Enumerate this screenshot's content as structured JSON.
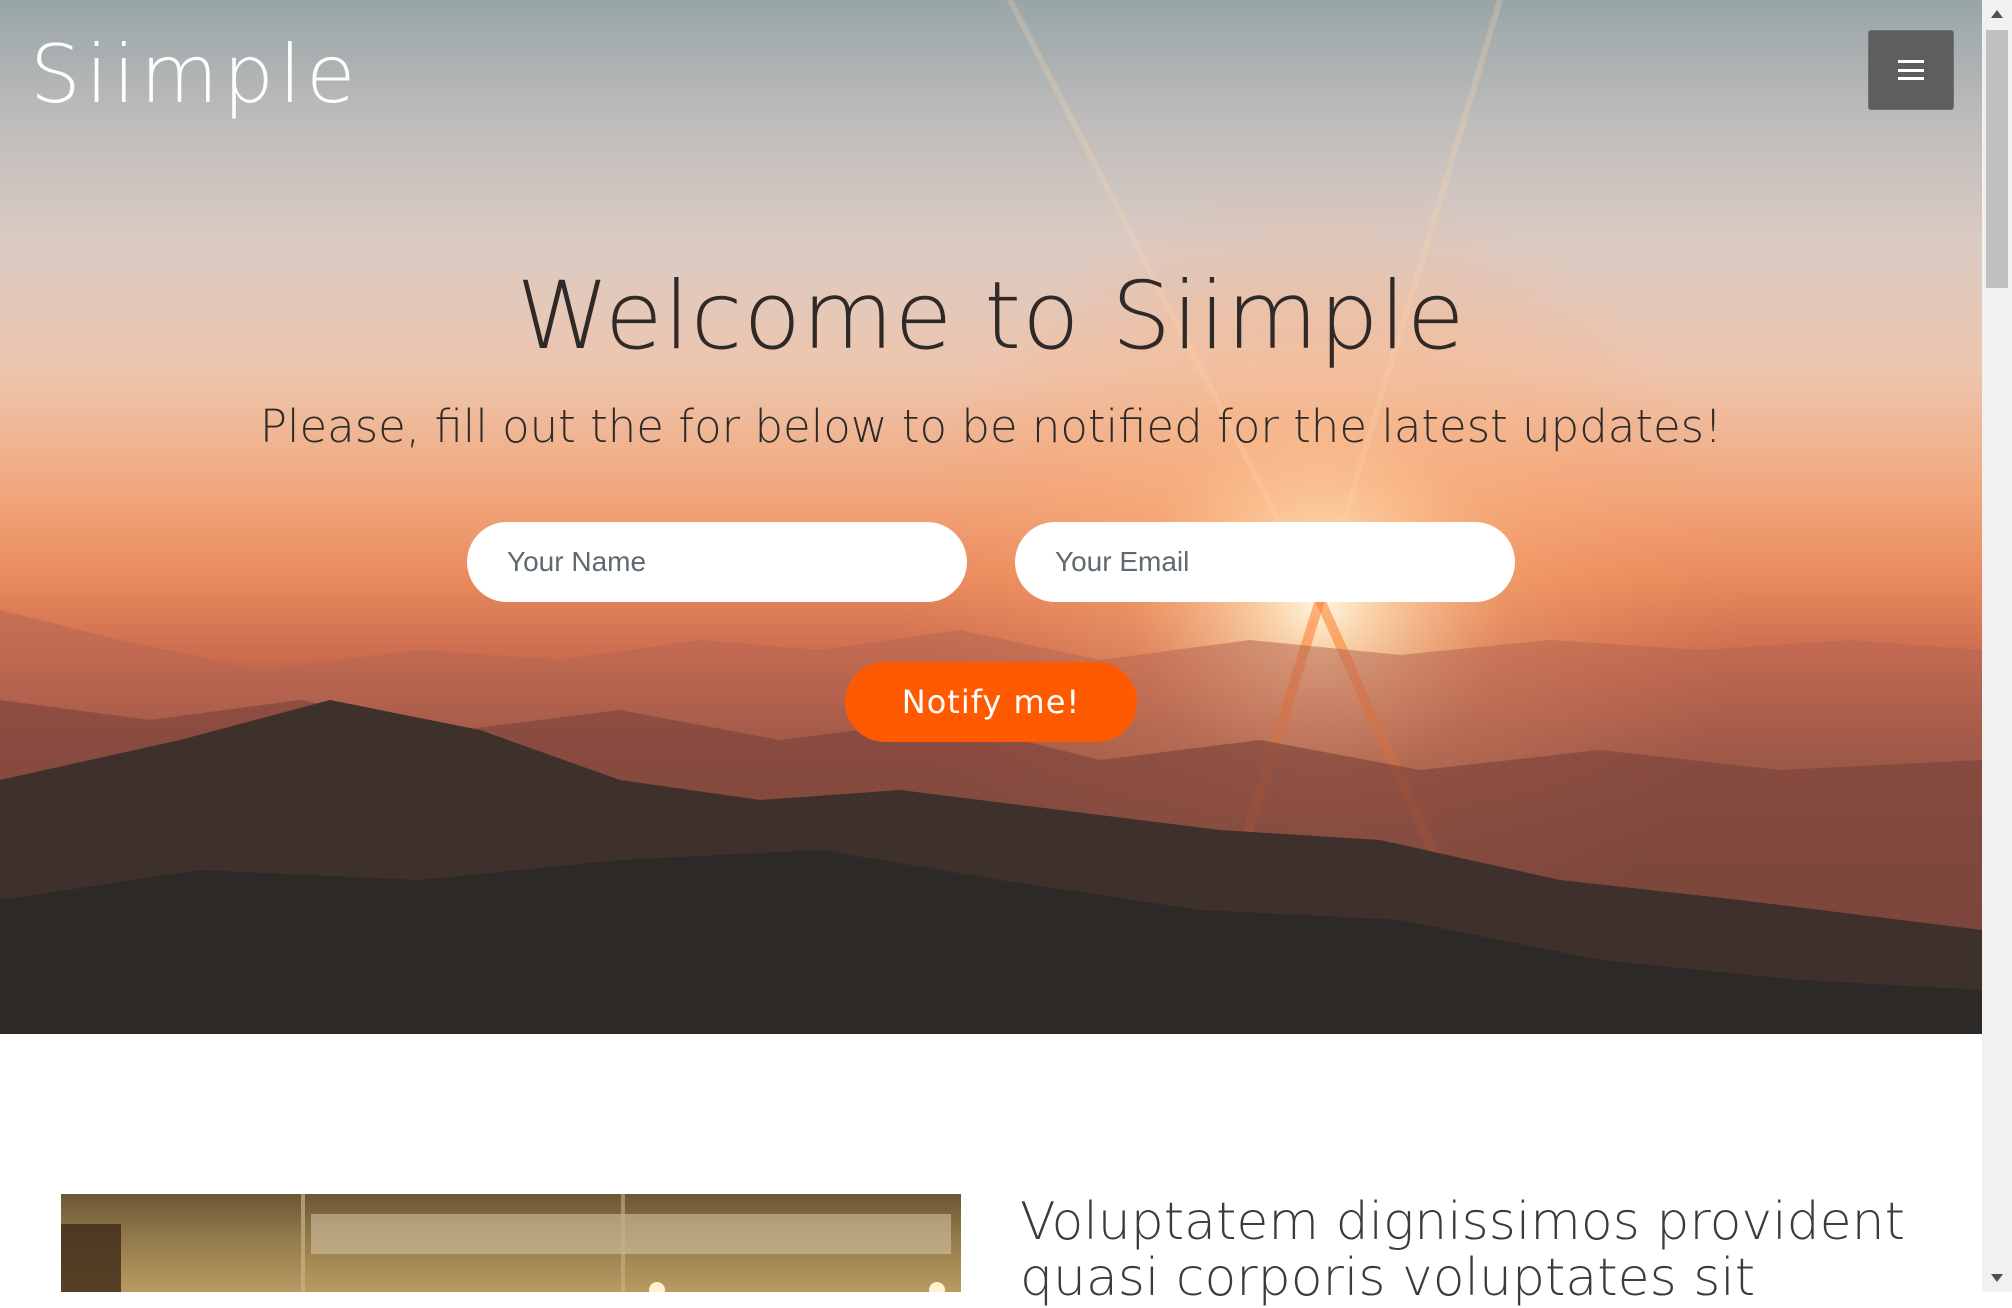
{
  "header": {
    "brand": "Siimple",
    "menu_icon": "hamburger-icon"
  },
  "hero": {
    "title": "Welcome to Siimple",
    "subtitle": "Please, fill out the for below to be notified for the latest updates!",
    "name_placeholder": "Your Name",
    "email_placeholder": "Your Email",
    "button_label": "Notify me!"
  },
  "section": {
    "heading": "Voluptatem dignissimos provident quasi corporis voluptates sit"
  },
  "colors": {
    "accent": "#ff5a00",
    "menu_button": "#5d5e5e"
  }
}
